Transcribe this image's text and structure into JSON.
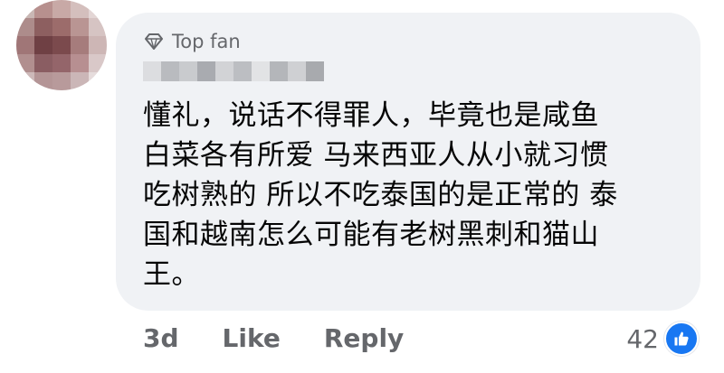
{
  "comment": {
    "badge_label": "Top fan",
    "lines": [
      "懂礼，说话不得罪人，毕竟也是咸鱼",
      "白菜各有所爱 马来西亚人从小就习惯",
      "吃树熟的 所以不吃泰国的是正常的 泰",
      "国和越南怎么可能有老树黑刺和猫山",
      "王。"
    ]
  },
  "actions": {
    "time": "3d",
    "like_label": "Like",
    "reply_label": "Reply"
  },
  "reactions": {
    "count": "42",
    "icon": "thumbs-up-icon"
  },
  "colors": {
    "bubble": "#f0f2f5",
    "meta_text": "#65676b",
    "body_text": "#050505",
    "like_blue": "#1877f2"
  }
}
